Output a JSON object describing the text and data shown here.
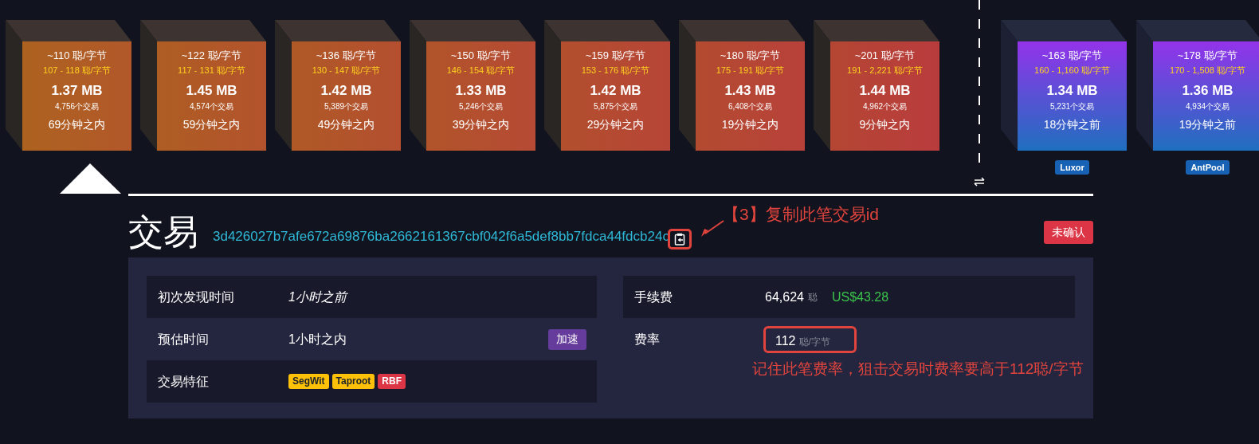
{
  "projected_blocks": [
    {
      "kind": "projected",
      "median_fee": "~110 聪/字节",
      "fee_range": "107 - 118 聪/字节",
      "size": "1.37 MB",
      "tx_count": "4,756个交易",
      "time": "69分钟之内"
    },
    {
      "kind": "projected",
      "median_fee": "~122 聪/字节",
      "fee_range": "117 - 131 聪/字节",
      "size": "1.45 MB",
      "tx_count": "4,574个交易",
      "time": "59分钟之内"
    },
    {
      "kind": "projected",
      "median_fee": "~136 聪/字节",
      "fee_range": "130 - 147 聪/字节",
      "size": "1.42 MB",
      "tx_count": "5,389个交易",
      "time": "49分钟之内"
    },
    {
      "kind": "projected",
      "median_fee": "~150 聪/字节",
      "fee_range": "146 - 154 聪/字节",
      "size": "1.33 MB",
      "tx_count": "5,246个交易",
      "time": "39分钟之内"
    },
    {
      "kind": "projected",
      "median_fee": "~159 聪/字节",
      "fee_range": "153 - 176 聪/字节",
      "size": "1.42 MB",
      "tx_count": "5,875个交易",
      "time": "29分钟之内"
    },
    {
      "kind": "projected",
      "median_fee": "~180 聪/字节",
      "fee_range": "175 - 191 聪/字节",
      "size": "1.43 MB",
      "tx_count": "6,408个交易",
      "time": "19分钟之内"
    },
    {
      "kind": "projected",
      "median_fee": "~201 聪/字节",
      "fee_range": "191 - 2,221 聪/字节",
      "size": "1.44 MB",
      "tx_count": "4,962个交易",
      "time": "9分钟之内"
    }
  ],
  "mined_blocks": [
    {
      "kind": "mined",
      "median_fee": "~163 聪/字节",
      "fee_range": "160 - 1,160 聪/字节",
      "size": "1.34 MB",
      "tx_count": "5,231个交易",
      "time": "18分钟之前",
      "pool": "Luxor"
    },
    {
      "kind": "mined",
      "median_fee": "~178 聪/字节",
      "fee_range": "170 - 1,508 聪/字节",
      "size": "1.36 MB",
      "tx_count": "4,934个交易",
      "time": "19分钟之前",
      "pool": "AntPool"
    }
  ],
  "transaction": {
    "title": "交易",
    "txid": "3d426027b7afe672a69876ba2662161367cbf042f6a5def8bb7fdca44fdcb24c",
    "status": "未确认",
    "copy_annotation": "【3】复制此笔交易id",
    "left_rows": [
      {
        "kind": "italic",
        "label": "初次发现时间",
        "value": "1小时之前"
      },
      {
        "kind": "action",
        "label": "预估时间",
        "value": "1小时之内",
        "button": "加速"
      },
      {
        "kind": "tags",
        "label": "交易特征",
        "tags": [
          {
            "text": "SegWit",
            "color": "#ffc107"
          },
          {
            "text": "Taproot",
            "color": "#ffc107"
          },
          {
            "text": "RBF",
            "color": "#dc3545"
          }
        ]
      }
    ],
    "fee": {
      "label": "手续费",
      "value": "64,624",
      "unit": "聪",
      "fiat": "US$43.28"
    },
    "fee_rate": {
      "label": "费率",
      "value": "112",
      "unit": "聪/字节"
    },
    "fee_rate_annotation": "记住此笔费率，狙击交易时费率要高于112聪/字节"
  }
}
